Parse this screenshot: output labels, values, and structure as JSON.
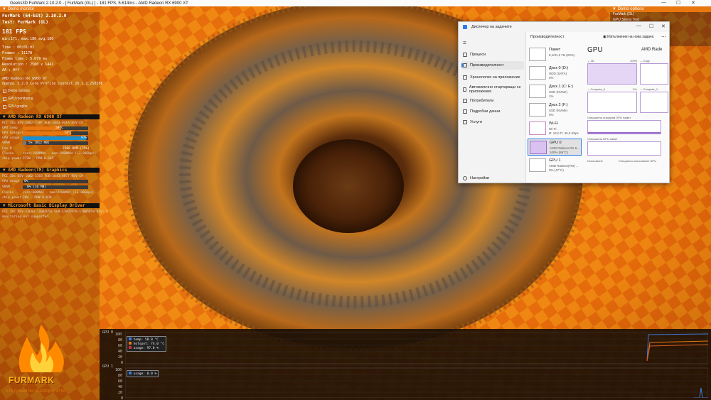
{
  "window_title": "Geeks3D FurMark 2.10.2.0 - [ FurMark (GL) ] - 181 FPS, 5.614ms - AMD Radeon RX 6900 XT",
  "window_controls": {
    "minimize": "—",
    "maximize": "☐",
    "close": "✕"
  },
  "left_panel": {
    "header": "Demo monitor",
    "app": "FurMark (64-bit) 2.10.2.0",
    "test": "Test: FurMark (GL)",
    "fps": "181 FPS",
    "fps_stats": "min:171, max:186  avg:180",
    "time": "Time        : 00:01:02",
    "frames": "Frames      : 11178",
    "frame_time": "Frame time  : 5.679 ms",
    "resolution": "Resolution  : 2560 x 1441",
    "aa": "AA          : Off",
    "gpu_name": "AMD Radeon RX 6900 XT",
    "opengl": "OpenGL 3.2.0 Core Profile Context 26.1.1.250108",
    "checks": [
      "Demo options",
      "GPU monitoring",
      "GPU graphs"
    ],
    "gpu1": {
      "title": "AMD Radeon RX 6900 XT",
      "pci": "PCI IDs   DEV-1002-73BF SUB-1043-04FA REV-C0",
      "temp_label": "GPU temp",
      "temp": "59°C",
      "temp_level": 0.59,
      "hotspot_label": "GPU hotspot",
      "hotspot": "74°C",
      "hotspot_level": 0.74,
      "usage_label": "GPU usage",
      "usage": "97%",
      "usage_level": 0.97,
      "vram_label": "VRAM",
      "vram": "5% (812 MB)",
      "vram_level": 0.05,
      "fan_label": "Fan 0",
      "fan": "2166 RPM (75%)",
      "fan_level": 0.75,
      "clocks_label": "Clocks",
      "clocks": "core:1909MHz - mem:1990MHz (13.98Gbps)",
      "power_label": "chip power",
      "power": "272W - PPW:0.665"
    },
    "gpu2": {
      "title": "AMD Radeon(TM) Graphics",
      "pci": "PCI IDs   DEV-1002-13C0 SUB-1043-8877 REV-C9",
      "usage_label": "GPU usage",
      "usage": "0%",
      "usage_level": 0.0,
      "vram_label": "VRAM",
      "vram": "0% (16 MB)",
      "vram_level": 0.0,
      "clocks_label": "Clocks",
      "clocks": "core:600MHz - mem:2200MHz (13.80Gbps)",
      "power_label": "chip power",
      "power": "36W - PPW:0.030"
    },
    "gpu3": {
      "title": "Microsoft Basic Display Driver",
      "pci": "PCI IDs   DEV-13C03-11005D59 SUB-11005D59-11005D59 REV: 0",
      "note": "monitoring not supported"
    }
  },
  "right_panel": {
    "header": "Demo options",
    "items": [
      "FurMark (GL)",
      "GPU Stress Test",
      "",
      "Deluxe",
      "",
      "Burn-in"
    ]
  },
  "graphs": {
    "gpu0_label": "GPU 0",
    "gpu1_label": "GPU 1",
    "axis": [
      "100",
      "80",
      "60",
      "40",
      "20",
      "0"
    ],
    "legend0": [
      "temp: 58.0 °C",
      "hotspot: 74.0 °C",
      "usage: 97.0 %"
    ],
    "legend1": [
      "usage: 0.0 %"
    ],
    "colors": {
      "temp": "#3d7bd6",
      "hotspot": "#e8770f",
      "usage": "#cc3333"
    }
  },
  "logo": {
    "text": "FURMARK",
    "build": "2.10.2.0 build Oct 26 2025@07:47:52"
  },
  "task_manager": {
    "title": "Диспечер на задачите",
    "section": "Производителност",
    "run_task": "Изпълнение на нова задача",
    "nav": [
      "Процеси",
      "Производителност",
      "Хронология на приложение",
      "Автоматично стартиращи се приложения",
      "Потребители",
      "Подробни данни",
      "Услуги"
    ],
    "settings": "Настройки",
    "devices": [
      {
        "name": "Памет",
        "l1": "6,1/31,2 ГБ (20%)",
        "l2": ""
      },
      {
        "name": "Диск 0 (D:)",
        "l1": "HDD (SATA)",
        "l2": "0%"
      },
      {
        "name": "Диск 1 (C: E:)",
        "l1": "SSD (NVMe)",
        "l2": "1%"
      },
      {
        "name": "Диск 2 (F:)",
        "l1": "SSD (NVMe)",
        "l2": "0%"
      },
      {
        "name": "Wi-Fi",
        "l1": "Wi-Fi",
        "l2": "И: 16,0 П: 40,0 Kbps"
      },
      {
        "name": "GPU 0",
        "l1": "AMD Radeon RX 6...",
        "l2": "100% (59°C)"
      },
      {
        "name": "GPU 1",
        "l1": "AMD Radeon(TM) ...",
        "l2": "0% (47°C)"
      }
    ],
    "gpu_title": "GPU",
    "gpu_model": "AMD Rade",
    "g3d": "3D",
    "g3d_pct": "100%",
    "copy": "Copy",
    "compute0": "Compute_0",
    "compute0_pct": "0%",
    "compute1": "Compute_1",
    "shared_mem_label": "Специална отредена GPU памет",
    "shared_gpu_label": "Специална GPU памет",
    "usage_label": "Използване",
    "shared_usage_label": "Специално използване GPU"
  }
}
